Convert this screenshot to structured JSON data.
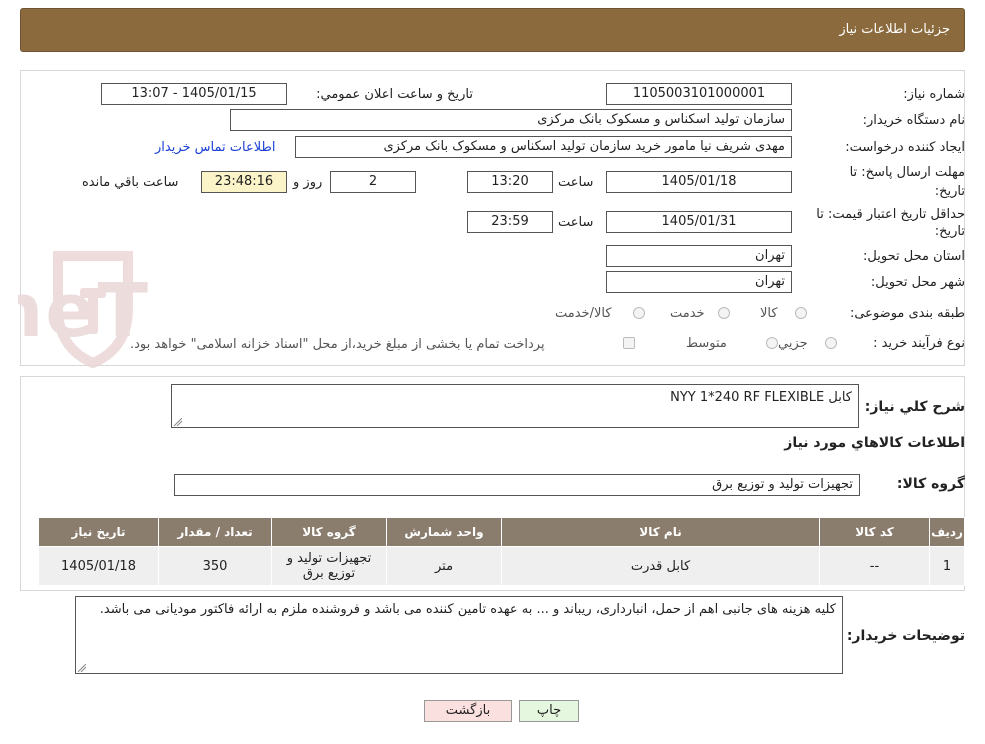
{
  "header": {
    "title": "جزئیات اطلاعات نیاز"
  },
  "form": {
    "need_number": {
      "label": "شماره نیاز:",
      "value": "1105003101000001"
    },
    "announce_datetime": {
      "label": "تاریخ و ساعت اعلان عمومي:",
      "value": "1405/01/15 - 13:07"
    },
    "buyer_org": {
      "label": "نام دستگاه خریدار:",
      "value": "سازمان تولید اسکناس و مسکوک بانک مرکزی"
    },
    "creator": {
      "label": "ایجاد کننده درخواست:",
      "value": "مهدی شریف نیا مامور خرید سازمان تولید اسکناس و مسکوک بانک مرکزی",
      "contact_link": "اطلاعات تماس خریدار"
    },
    "reply_deadline": {
      "label_line1": "مهلت ارسال پاسخ: تا",
      "label_line2": "تاریخ:",
      "date": "1405/01/18",
      "time_label": "ساعت",
      "time": "13:20",
      "days": "2",
      "days_label": "روز و",
      "remaining": "23:48:16",
      "remaining_label": "ساعت باقي مانده"
    },
    "price_validity": {
      "label_line1": "حداقل تاریخ اعتبار قیمت: تا",
      "label_line2": "تاریخ:",
      "date": "1405/01/31",
      "time_label": "ساعت",
      "time": "23:59"
    },
    "province": {
      "label": "استان محل تحویل:",
      "value": "تهران"
    },
    "city": {
      "label": "شهر محل تحویل:",
      "value": "تهران"
    },
    "category": {
      "label": "طبقه بندی موضوعی:",
      "options": [
        "کالا",
        "خدمت",
        "کالا/خدمت"
      ]
    },
    "purchase_type": {
      "label": "نوع فرآیند خرید :",
      "options": [
        "جزیي",
        "متوسط"
      ],
      "payment_note": "پرداخت تمام یا بخشی از مبلغ خرید،از محل \"اسناد خزانه اسلامی\" خواهد بود."
    }
  },
  "description": {
    "label": "شرح كلي نياز:",
    "value": "کابل NYY 1*240 RF FLEXIBLE"
  },
  "goods_section": {
    "title": "اطلاعات كالاهاي مورد نياز",
    "group_label": "گروه كالا:",
    "group_value": "تجهیزات تولید و توزیع برق"
  },
  "table": {
    "headers": [
      "رديف",
      "کد کالا",
      "نام کالا",
      "واحد شمارش",
      "گروه کالا",
      "تعداد / مقدار",
      "تاریخ نیاز"
    ],
    "rows": [
      [
        "1",
        "--",
        "کابل قدرت",
        "متر",
        "تجهیزات تولید و توزیع برق",
        "350",
        "1405/01/18"
      ]
    ]
  },
  "buyer_notes": {
    "label": "توضیحات خریدار:",
    "value": "کلیه هزینه های جانبی اهم از حمل، انبارداری، ریباند و ... به عهده تامین کننده می باشد و فروشنده ملزم به ارائه فاکتور مودیانی می باشد."
  },
  "buttons": {
    "print": "چاپ",
    "back": "بازگشت"
  },
  "watermark": {
    "text": "AriaTender.neT"
  },
  "colors": {
    "header_bg": "#8b6b3e",
    "table_header_bg": "#8b7d6e",
    "link": "#1a3fd6",
    "back_button_bg": "#fbe0e0",
    "print_button_bg": "#e6f7e0"
  }
}
